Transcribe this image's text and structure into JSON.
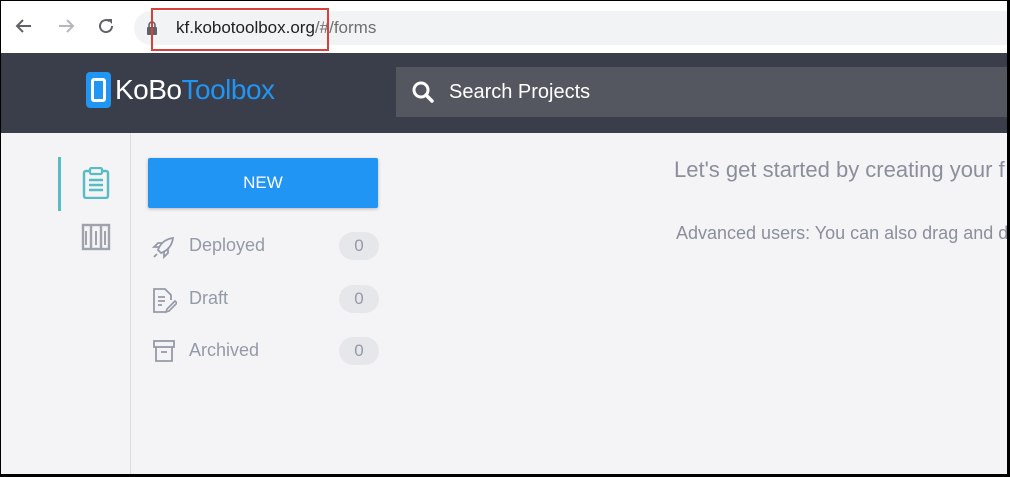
{
  "browser": {
    "url_host": "kf.kobotoolbox.org",
    "url_path": "/#/forms"
  },
  "header": {
    "logo_part1": "KoBo",
    "logo_part2": "Toolbox",
    "search_placeholder": "Search Projects"
  },
  "sidebar": {
    "new_button": "NEW",
    "items": [
      {
        "label": "Deployed",
        "count": "0",
        "icon": "rocket-icon"
      },
      {
        "label": "Draft",
        "count": "0",
        "icon": "draft-icon"
      },
      {
        "label": "Archived",
        "count": "0",
        "icon": "archive-icon"
      }
    ]
  },
  "main": {
    "heading": "Let's get started by creating your f",
    "subtext": "Advanced users: You can also drag and dro"
  },
  "colors": {
    "brand_blue": "#2095f3",
    "header_bg": "#3a3e4a",
    "rail_accent": "#58bcc5",
    "annotation_red": "#d9403b"
  }
}
